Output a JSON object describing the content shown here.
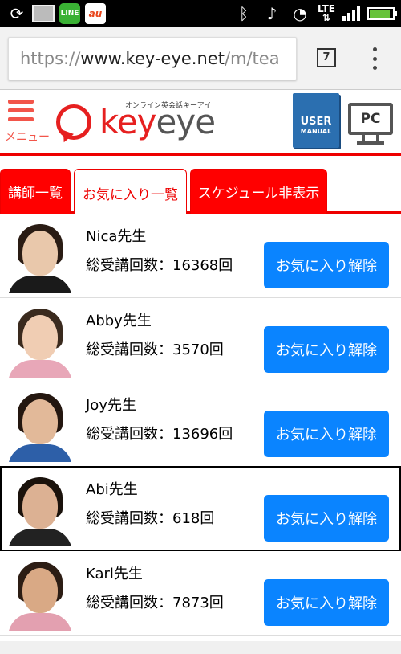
{
  "status_bar": {
    "lte": "LTE",
    "line_label": "LINE",
    "au_label": "au",
    "battery_level": 0.9,
    "signal_bars": 4
  },
  "browser": {
    "url_scheme": "https://",
    "url_host": "www.key-eye.net",
    "url_path": "/m/tea",
    "tab_count": "7"
  },
  "site_header": {
    "menu_label": "メニュー",
    "logo_tagline": "オンライン英会話キーアイ",
    "logo_key": "key",
    "logo_eye": "eye",
    "manual_user": "USER",
    "manual_manual": "MANUAL",
    "pc_label": "PC",
    "accent_color": "#e62020"
  },
  "tabs": [
    {
      "label": "講師一覧"
    },
    {
      "label": "お気に入り一覧"
    },
    {
      "label": "スケジュール非表示"
    }
  ],
  "teachers": [
    {
      "name": "Nica先生",
      "count": "総受講回数：16368回",
      "button": "お気に入り解除"
    },
    {
      "name": "Abby先生",
      "count": "総受講回数：3570回",
      "button": "お気に入り解除"
    },
    {
      "name": "Joy先生",
      "count": "総受講回数：13696回",
      "button": "お気に入り解除"
    },
    {
      "name": "Abi先生",
      "count": "総受講回数：618回",
      "button": "お気に入り解除"
    },
    {
      "name": "Karl先生",
      "count": "総受講回数：7873回",
      "button": "お気に入り解除"
    }
  ]
}
